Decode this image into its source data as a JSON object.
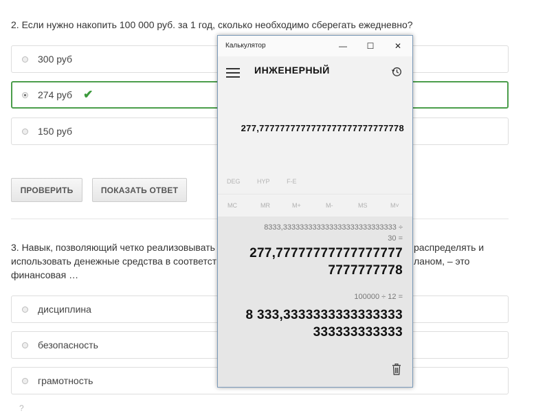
{
  "question2": {
    "text": "2. Если нужно накопить 100 000 руб. за 1 год, сколько необходимо сберегать ежедневно?",
    "options": [
      {
        "label": "300 руб",
        "selected": false
      },
      {
        "label": "274 руб",
        "selected": true,
        "correct": true
      },
      {
        "label": "150 руб",
        "selected": false
      }
    ]
  },
  "buttons": {
    "check": "ПРОВЕРИТЬ",
    "show_answer": "ПОКАЗАТЬ ОТВЕТ"
  },
  "question3": {
    "line1_left": "3. Навык, позволяющий четко реализовывать",
    "line1_right": "распределять и",
    "line2_left": "использовать денежные средства в соответст",
    "line2_right": "ланом, – это",
    "line3": "финансовая …",
    "options": [
      {
        "label": "дисциплина"
      },
      {
        "label": "безопасность"
      },
      {
        "label": "грамотность"
      }
    ],
    "next_partial": "?"
  },
  "calculator": {
    "window_title": "Калькулятор",
    "window_buttons": {
      "minimize": "—",
      "maximize": "☐",
      "close": "✕"
    },
    "mode": "ИНЖЕНЕРНЫЙ",
    "display": "277,7777777777777777777777777778",
    "angle_modes": [
      "DEG",
      "HYP",
      "F-E"
    ],
    "memory": [
      "MC",
      "MR",
      "M+",
      "M-",
      "MS",
      "M˅"
    ],
    "history": [
      {
        "expr_line1": "8333,333333333333333333333333333  ÷",
        "expr_line2": "30 =",
        "result_line1": "277,77777777777777777",
        "result_line2": "7777777778"
      },
      {
        "expr_line1": "100000  ÷  12 =",
        "result_line1": "8 333,3333333333333333",
        "result_line2": "333333333333"
      }
    ]
  }
}
